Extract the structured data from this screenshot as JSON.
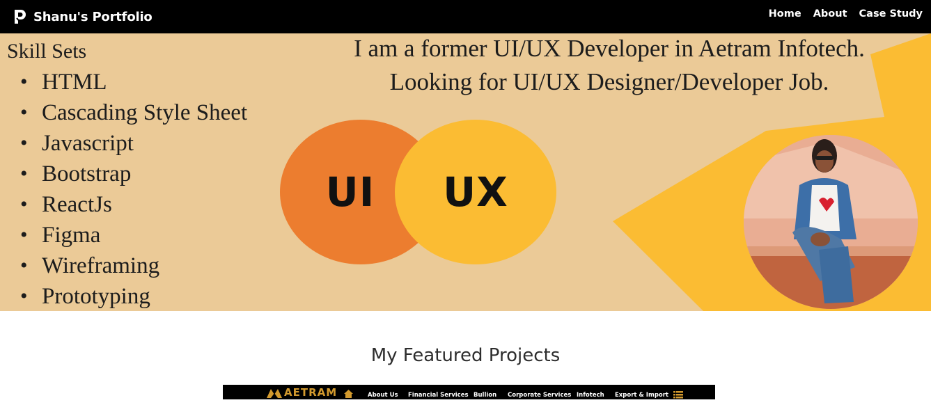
{
  "navbar": {
    "brand": "Shanu's Portfolio",
    "brand_icon": "portfolio-logo-icon",
    "links": [
      "Home",
      "About",
      "Case Study"
    ]
  },
  "hero": {
    "skills_title": "Skill Sets",
    "skills": [
      "HTML",
      "Cascading Style Sheet",
      "Javascript",
      "Bootstrap",
      "ReactJs",
      "Figma",
      "Wireframing",
      "Prototyping"
    ],
    "headline_line1": "I am a former UI/UX Developer in Aetram Infotech.",
    "headline_line2": "Looking for UI/UX Designer/Developer Job.",
    "circle_ui": "UI",
    "circle_ux": "UX",
    "avatar_icon": "profile-photo",
    "colors": {
      "background": "#ebca97",
      "ui_circle": "#ec7d2f",
      "ux_circle": "#fbbc33",
      "accent_shape": "#fbbc33"
    }
  },
  "featured": {
    "title": "My Featured Projects",
    "preview": {
      "logo_text": "AETRAM",
      "menu": [
        "About Us",
        "Financial Services",
        "Bullion",
        "Corporate Services",
        "Infotech",
        "Export & Import"
      ],
      "logo_color": "#d39a2e"
    }
  }
}
